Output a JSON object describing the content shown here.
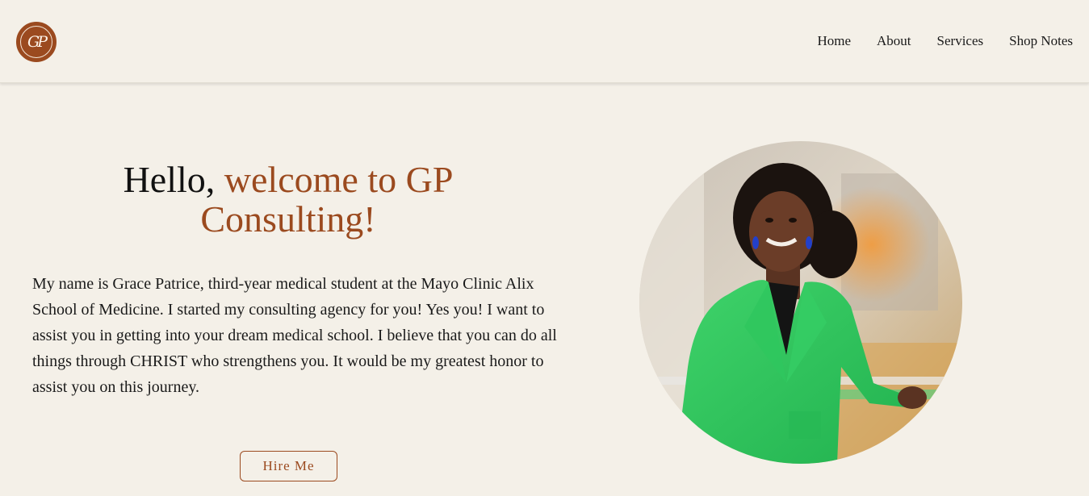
{
  "logo": {
    "text": "GP",
    "color": "#9b4a1f"
  },
  "nav": {
    "items": [
      {
        "label": "Home"
      },
      {
        "label": "About"
      },
      {
        "label": "Services"
      },
      {
        "label": "Shop Notes"
      }
    ]
  },
  "hero": {
    "headline_lead": "Hello,",
    "headline_accent": "welcome to GP Consulting!",
    "bio": "My name is Grace Patrice, third-year medical student at the Mayo Clinic Alix School of Medicine. I started my consulting agency for you! Yes you! I want to assist you in getting into your dream medical school. I believe that you can do all things through CHRIST who strengthens you. It would be my greatest honor to assist you on this journey.",
    "cta_label": "Hire Me",
    "accent_color": "#9b4a1f",
    "background_color": "#f4f0e8",
    "portrait_icon": "portrait-photo"
  }
}
